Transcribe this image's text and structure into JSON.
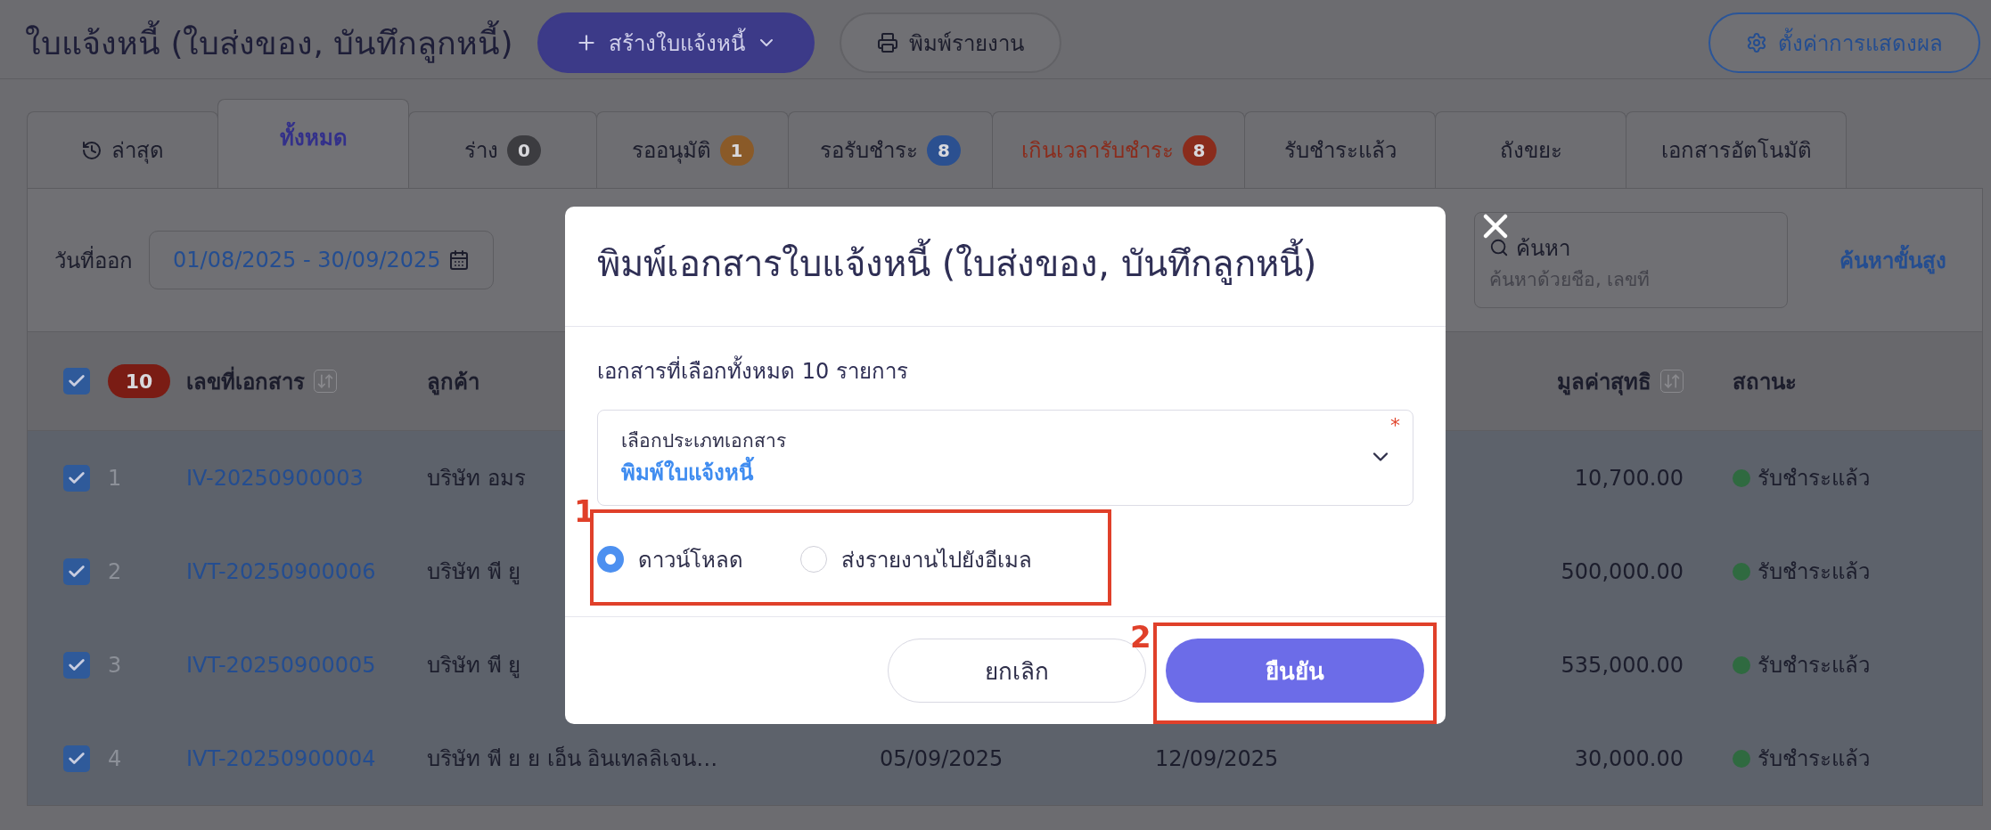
{
  "page": {
    "title": "ใบแจ้งหนี้ (ใบส่งของ, บันทึกลูกหนี้)",
    "create_button": "สร้างใบแจ้งหนี้",
    "print_button": "พิมพ์รายงาน",
    "settings_button": "ตั้งค่าการแสดงผล"
  },
  "tabs": [
    {
      "label": "ล่าสุด",
      "kind": "history",
      "alert": false,
      "selected": false
    },
    {
      "label": "ทั้งหมด",
      "kind": "plain",
      "alert": false,
      "selected": true
    },
    {
      "label": "ร่าง",
      "kind": "count",
      "badge": "0",
      "color": "#3c3c40",
      "alert": false,
      "selected": false
    },
    {
      "label": "รออนุมัติ",
      "kind": "count",
      "badge": "1",
      "color": "#8a5a28",
      "alert": false,
      "selected": false
    },
    {
      "label": "รอรับชำระ",
      "kind": "count",
      "badge": "8",
      "color": "#2b5090",
      "alert": false,
      "selected": false
    },
    {
      "label": "เกินเวลารับชำระ",
      "kind": "count",
      "badge": "8",
      "color": "#8a2c1c",
      "alert": true,
      "selected": false
    },
    {
      "label": "รับชำระแล้ว",
      "kind": "plain",
      "alert": false,
      "selected": false
    },
    {
      "label": "ถังขยะ",
      "kind": "plain",
      "alert": false,
      "selected": false
    },
    {
      "label": "เอกสารอัตโนมัติ",
      "kind": "plain",
      "alert": false,
      "selected": false
    }
  ],
  "filters": {
    "date_label": "วันที่ออก",
    "date_range": "01/08/2025 - 30/09/2025",
    "search_label": "ค้นหา",
    "search_placeholder": "ค้นหาด้วยชื่อ, เลขที่",
    "advanced_search": "ค้นหาขั้นสูง"
  },
  "table": {
    "all_checked": true,
    "selected_count": "10",
    "columns": [
      {
        "label": "เลขที่เอกสาร",
        "sortable": true
      },
      {
        "label": "ลูกค้า",
        "sortable": false
      },
      {
        "label": "มูลค่าสุทธิ",
        "sortable": true
      },
      {
        "label": "สถานะ",
        "sortable": false
      }
    ],
    "rows": [
      {
        "checked": true,
        "number": "1",
        "doc_no": "IV-20250900003",
        "customer": "บริษัท อมร",
        "amount": "10,700.00",
        "status": "รับชำระแล้ว",
        "color": "#2f6a40"
      },
      {
        "checked": true,
        "number": "2",
        "doc_no": "IVT-20250900006",
        "customer": "บริษัท พี ยู",
        "amount": "500,000.00",
        "status": "รับชำระแล้ว",
        "color": "#2f6a40"
      },
      {
        "checked": true,
        "number": "3",
        "doc_no": "IVT-20250900005",
        "customer": "บริษัท พี ยู",
        "amount": "535,000.00",
        "status": "รับชำระแล้ว",
        "color": "#2f6a40"
      },
      {
        "checked": true,
        "number": "4",
        "doc_no": "IVT-20250900004",
        "customer": "บริษัท พี ย ย เอ็น อินเทลลิเจน…",
        "issue_date": "05/09/2025",
        "due_date": "12/09/2025",
        "amount": "30,000.00",
        "status": "รับชำระแล้ว",
        "color": "#2f6a40"
      }
    ]
  },
  "dialog": {
    "title": "พิมพ์เอกสารใบแจ้งหนี้ (ใบส่งของ, บันทึกลูกหนี้)",
    "summary": "เอกสารที่เลือกทั้งหมด 10 รายการ",
    "select_label": "เลือกประเภทเอกสาร",
    "select_value": "พิมพ์ใบแจ้งหนี้",
    "required_mark": "*",
    "options": [
      {
        "label": "ดาวน์โหลด",
        "selected": true
      },
      {
        "label": "ส่งรายงานไปยังอีเมล",
        "selected": false
      }
    ],
    "cancel": "ยกเลิก",
    "confirm": "ยืนยัน",
    "options_callout": "1",
    "confirm_callout": "2"
  }
}
